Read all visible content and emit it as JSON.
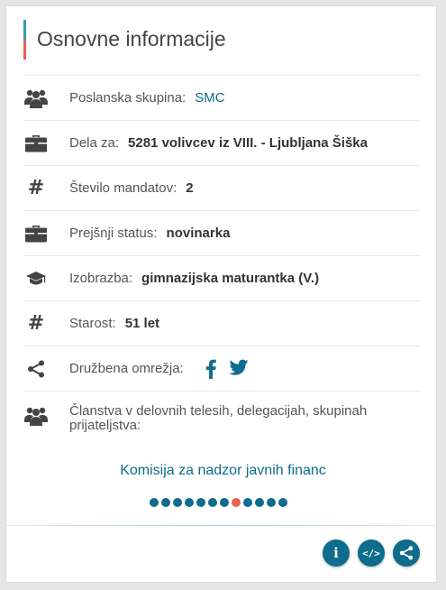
{
  "header": {
    "title": "Osnovne informacije"
  },
  "rows": [
    {
      "icon": "group-icon",
      "label": "Poslanska skupina:",
      "value": "SMC"
    },
    {
      "icon": "briefcase-icon",
      "label": "Dela za:",
      "value": "5281 volivcev iz VIII. - Ljubljana Šiška"
    },
    {
      "icon": "hash-icon",
      "label": "Število mandatov:",
      "value": "2"
    },
    {
      "icon": "briefcase-icon",
      "label": "Prejšnji status:",
      "value": "novinarka"
    },
    {
      "icon": "graduation-cap-icon",
      "label": "Izobrazba:",
      "value": "gimnazijska maturantka (V.)"
    },
    {
      "icon": "hash-icon",
      "label": "Starost:",
      "value": "51 let"
    },
    {
      "icon": "share-icon",
      "label": "Družbena omrežja:",
      "social": [
        "facebook-icon",
        "twitter-icon"
      ]
    },
    {
      "icon": "group-icon",
      "label": "Članstva v delovnih telesih, delegacijah, skupinah prijateljstva:"
    }
  ],
  "carousel": {
    "current_item": "Komisija za nadzor javnih financ",
    "total": 12,
    "active_index": 7
  },
  "footer": {
    "info_label": "i",
    "embed_label": "</>",
    "icons": [
      "info-icon",
      "embed-code-icon",
      "share-icon"
    ]
  },
  "colors": {
    "accent": "#0e6c8c",
    "active_dot": "#e8624a",
    "title_bar_top": "#3a99b4"
  }
}
